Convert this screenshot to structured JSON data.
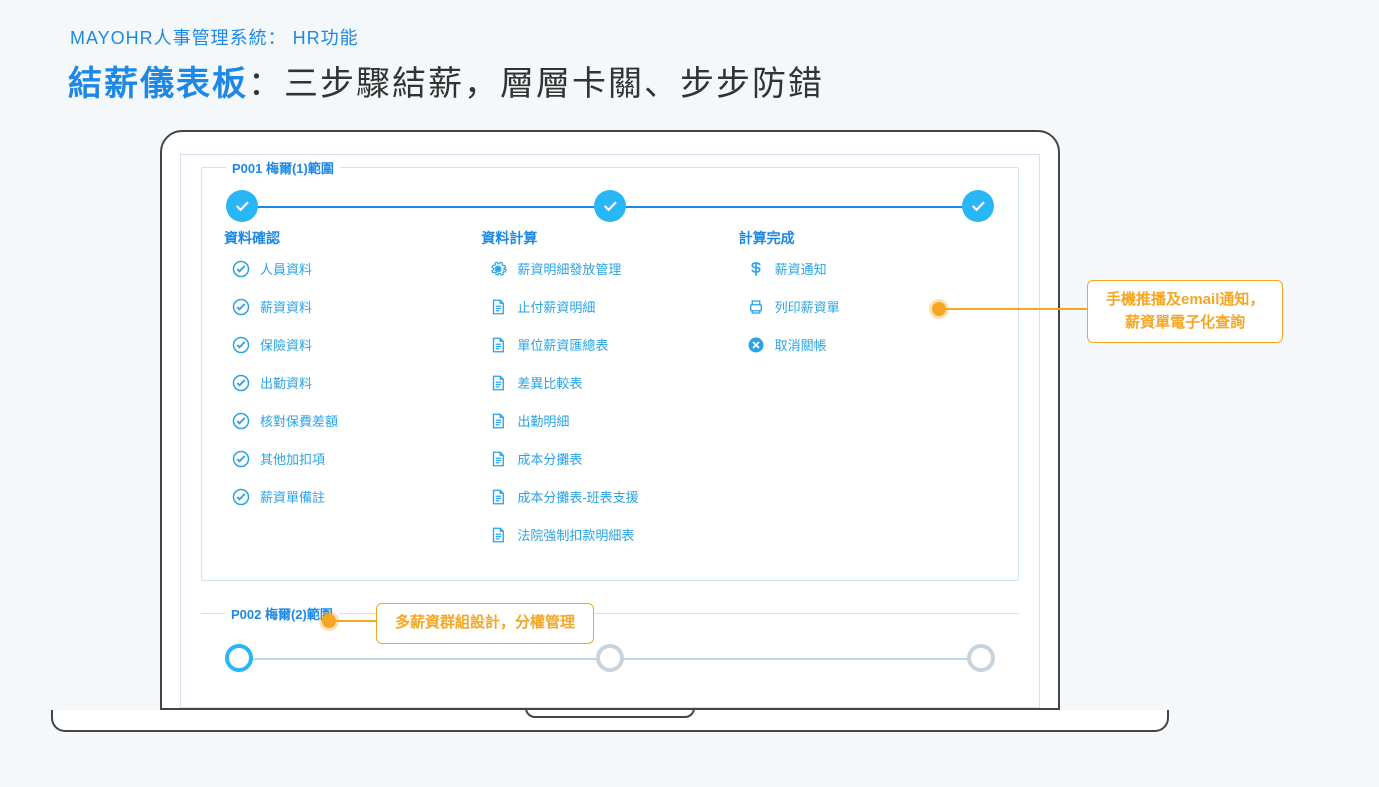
{
  "header": {
    "eyebrow": "MAYOHR人事管理系統： HR功能",
    "title_accent": "結薪儀表板",
    "title_rest": "：三步驟結薪，層層卡關、步步防錯"
  },
  "group1": {
    "legend": "P001 梅爾(1)範圍",
    "steps": [
      {
        "label": "資料確認"
      },
      {
        "label": "資料計算"
      },
      {
        "label": "計算完成"
      }
    ],
    "col1_items": [
      {
        "icon": "check-circle",
        "label": "人員資料"
      },
      {
        "icon": "check-circle",
        "label": "薪資資料"
      },
      {
        "icon": "check-circle",
        "label": "保險資料"
      },
      {
        "icon": "check-circle",
        "label": "出勤資料"
      },
      {
        "icon": "check-circle",
        "label": "核對保費差額"
      },
      {
        "icon": "check-circle",
        "label": "其他加扣項"
      },
      {
        "icon": "check-circle",
        "label": "薪資單備註"
      }
    ],
    "col2_items": [
      {
        "icon": "gear",
        "label": "薪資明細發放管理"
      },
      {
        "icon": "doc",
        "label": "止付薪資明細"
      },
      {
        "icon": "doc",
        "label": "單位薪資匯總表"
      },
      {
        "icon": "doc",
        "label": "差異比較表"
      },
      {
        "icon": "doc",
        "label": "出勤明細"
      },
      {
        "icon": "doc",
        "label": "成本分攤表"
      },
      {
        "icon": "doc",
        "label": "成本分攤表-班表支援"
      },
      {
        "icon": "doc",
        "label": "法院強制扣款明細表"
      }
    ],
    "col3_items": [
      {
        "icon": "dollar",
        "label": "薪資通知"
      },
      {
        "icon": "print",
        "label": "列印薪資單"
      },
      {
        "icon": "x-circle",
        "label": "取消關帳"
      }
    ]
  },
  "group2": {
    "legend": "P002 梅爾(2)範圍"
  },
  "callouts": {
    "right": "手機推播及email通知，\n薪資單電子化查詢",
    "right_l1": "手機推播及email通知，",
    "right_l2": "薪資單電子化查詢",
    "bottom": "多薪資群組設計，分權管理"
  },
  "colors": {
    "accent": "#1e88e5",
    "callout": "#f5a623"
  }
}
